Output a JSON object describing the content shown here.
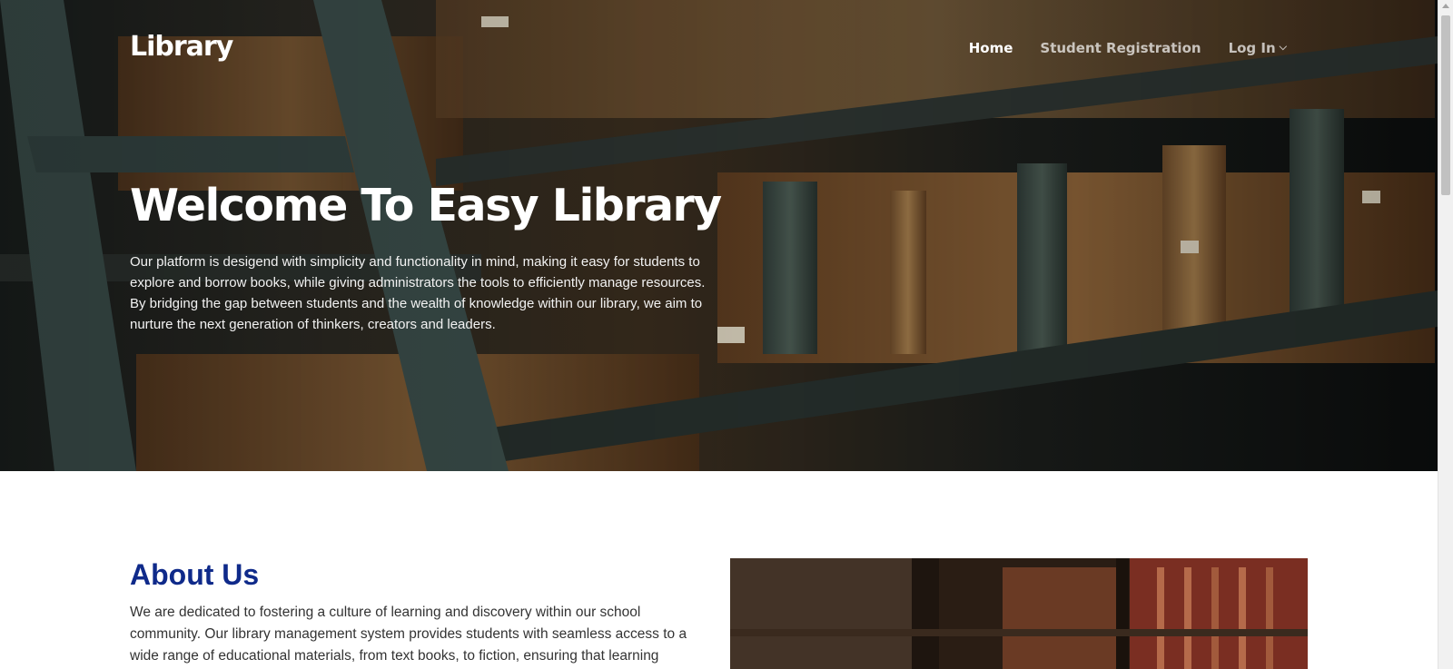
{
  "brand": "Library",
  "nav": {
    "home": "Home",
    "registration": "Student Registration",
    "login": "Log In"
  },
  "hero": {
    "title": "Welcome To Easy Library",
    "text": "Our platform is desigend with simplicity and functionality in mind, making it easy for students to explore and borrow books, while giving administrators the tools to efficiently manage resources. By bridging the gap between students and the wealth of knowledge within our library, we aim to nurture the next generation of thinkers, creators and leaders."
  },
  "about": {
    "title": "About Us",
    "text": "We are dedicated to fostering a culture of learning and discovery within our school community. Our library management system provides students with seamless access to a wide range of educational materials, from text books, to fiction, ensuring that learning"
  },
  "colors": {
    "about_title": "#0f2a8a",
    "hero_text": "#ffffff"
  },
  "icons": {
    "login_dropdown": "chevron-down-icon"
  }
}
